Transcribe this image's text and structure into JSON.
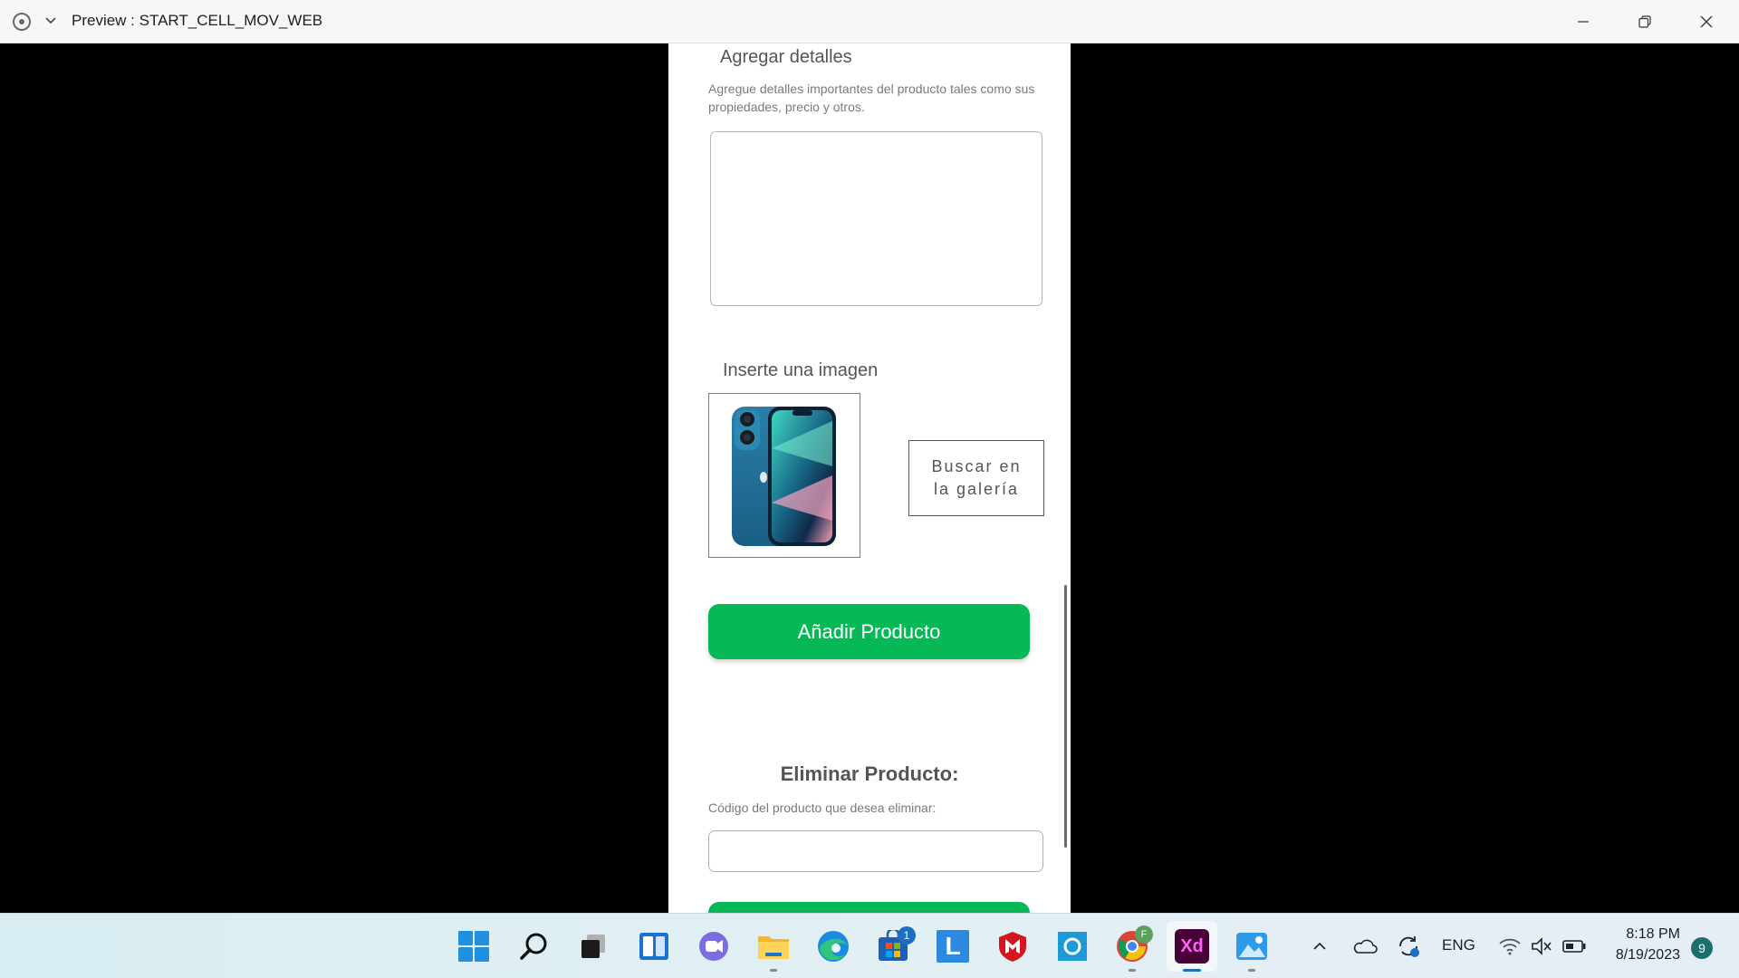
{
  "window": {
    "title": "Preview : START_CELL_MOV_WEB"
  },
  "form": {
    "details_title": "Agregar detalles",
    "details_description": "Agregue detalles importantes del producto tales como sus propiedades, precio y otros.",
    "details_value": "",
    "image_title": "Inserte una imagen",
    "image_alt": "iPhone azul",
    "gallery_button_label": "Buscar en la galería",
    "add_button_label": "Añadir Producto"
  },
  "delete_section": {
    "title": "Eliminar Producto:",
    "label": "Código del producto que desea eliminar:",
    "input_value": ""
  },
  "colors": {
    "accent_green": "#07b857",
    "xd_purple": "#470137",
    "xd_magenta": "#ff61f6"
  },
  "taskbar": {
    "icons": [
      "windows-start-icon",
      "search-icon",
      "task-view-icon",
      "widgets-icon",
      "teams-chat-icon",
      "file-explorer-icon",
      "edge-icon",
      "microsoft-store-icon",
      "l-app-icon",
      "mcafee-icon",
      "cortana-icon",
      "chrome-icon",
      "adobe-xd-icon",
      "photos-icon"
    ],
    "store_badge": "1",
    "chrome_profile_letter": "F",
    "xd_label": "Xd",
    "l_label": "L"
  },
  "tray": {
    "language": "ENG",
    "time": "8:18 PM",
    "date": "8/19/2023",
    "notification_count": "9"
  }
}
